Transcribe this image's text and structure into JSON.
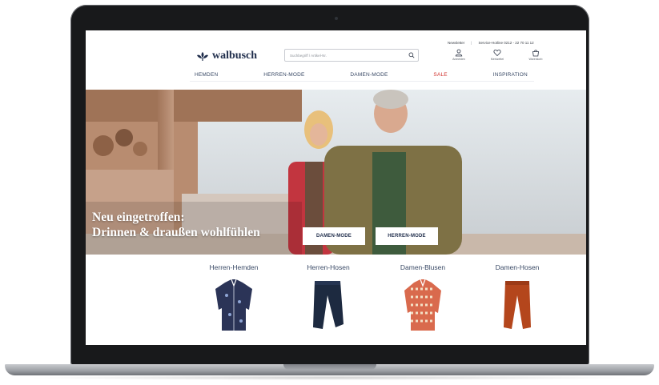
{
  "brand": {
    "name": "walbusch"
  },
  "search": {
    "placeholder": "Suchbegriff / Artikel-Nr."
  },
  "service": {
    "newsletter": "Newsletter",
    "hotline": "Service-Hotline 0212 - 22 70 11 12"
  },
  "user_icons": [
    {
      "icon": "user-icon",
      "label": "Anmelden"
    },
    {
      "icon": "heart-icon",
      "label": "Merkzettel"
    },
    {
      "icon": "bag-icon",
      "label": "Warenkorb"
    }
  ],
  "nav": {
    "items": [
      {
        "label": "HEMDEN"
      },
      {
        "label": "HERREN-MODE"
      },
      {
        "label": "DAMEN-MODE"
      },
      {
        "label": "SALE"
      },
      {
        "label": "INSPIRATION"
      }
    ],
    "sale_color": "#d0312d"
  },
  "hero": {
    "title_line1": "Neu eingetroffen:",
    "title_line2": "Drinnen & draußen wohlfühlen",
    "buttons": {
      "damen": "DAMEN-MODE",
      "herren": "HERREN-MODE"
    }
  },
  "categories": [
    {
      "label": "Herren-Hemden",
      "product": "shirt"
    },
    {
      "label": "Herren-Hosen",
      "product": "trousers"
    },
    {
      "label": "Damen-Blusen",
      "product": "blouse"
    },
    {
      "label": "Damen-Hosen",
      "product": "trousers"
    }
  ],
  "colors": {
    "brand_navy": "#1f2d4b",
    "text_blue": "#3a4a66",
    "sale_red": "#d0312d"
  }
}
